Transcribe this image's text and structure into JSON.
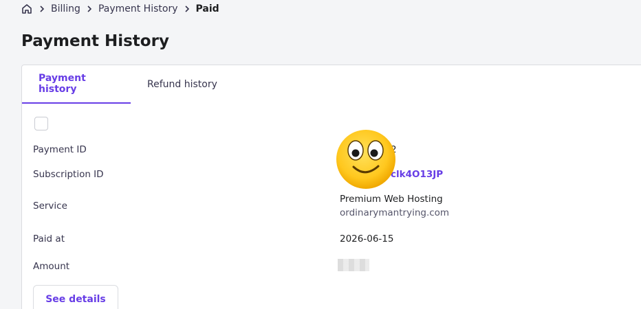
{
  "breadcrumb": {
    "items": [
      "Billing",
      "Payment History"
    ],
    "current": "Paid"
  },
  "page_title": "Payment History",
  "tabs": [
    {
      "label": "Payment history",
      "active": true
    },
    {
      "label": "Refund history",
      "active": false
    }
  ],
  "details": {
    "payment_id_label": "Payment ID",
    "payment_id_value": "2",
    "subscription_id_label": "Subscription ID",
    "subscription_id_value": "clk4O13JP",
    "service_label": "Service",
    "service_name": "Premium Web Hosting",
    "service_domain": "ordinarymantrying.com",
    "paid_at_label": "Paid at",
    "paid_at_value": "2026-06-15",
    "amount_label": "Amount"
  },
  "actions": {
    "see_details": "See details"
  },
  "colors": {
    "accent": "#673de6",
    "text": "#1d1e20",
    "muted": "#36344d",
    "border": "#dadce0"
  }
}
